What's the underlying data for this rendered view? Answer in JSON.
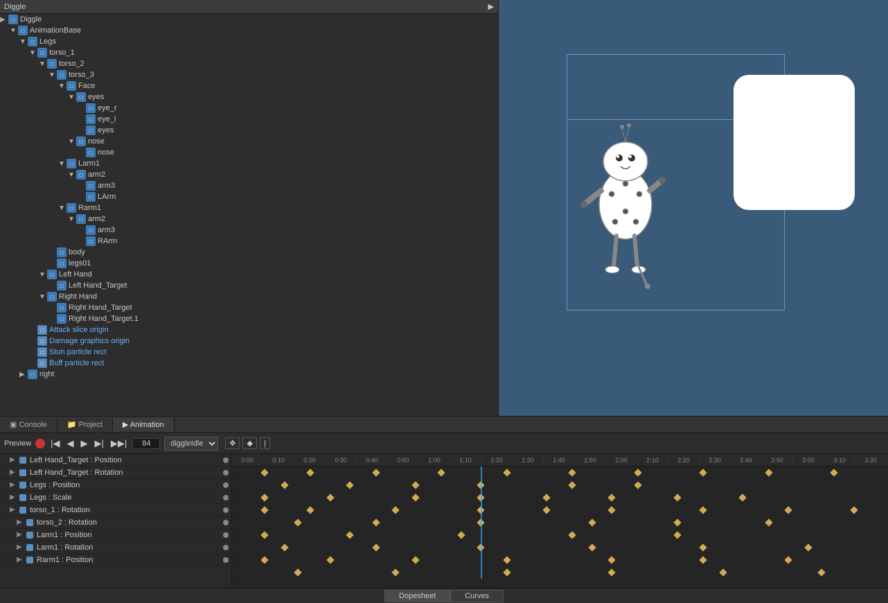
{
  "header": {
    "title": "Diggle"
  },
  "hierarchy": {
    "items": [
      {
        "id": "diggle",
        "label": "Diggle",
        "indent": 0,
        "arrow": "▶",
        "icon": "cube",
        "colored": false
      },
      {
        "id": "animation-base",
        "label": "AnimationBase",
        "indent": 1,
        "arrow": "▼",
        "icon": "cube",
        "colored": false
      },
      {
        "id": "legs",
        "label": "Legs",
        "indent": 2,
        "arrow": "▼",
        "icon": "cube",
        "colored": false
      },
      {
        "id": "torso_1",
        "label": "torso_1",
        "indent": 3,
        "arrow": "▼",
        "icon": "cube",
        "colored": false
      },
      {
        "id": "torso_2",
        "label": "torso_2",
        "indent": 4,
        "arrow": "▼",
        "icon": "cube",
        "colored": false
      },
      {
        "id": "torso_3",
        "label": "torso_3",
        "indent": 5,
        "arrow": "▼",
        "icon": "cube",
        "colored": false
      },
      {
        "id": "face",
        "label": "Face",
        "indent": 6,
        "arrow": "▼",
        "icon": "cube",
        "colored": false
      },
      {
        "id": "eyes",
        "label": "eyes",
        "indent": 7,
        "arrow": "▼",
        "icon": "cube",
        "colored": false
      },
      {
        "id": "eye_r",
        "label": "eye_r",
        "indent": 8,
        "arrow": "",
        "icon": "cube",
        "colored": false
      },
      {
        "id": "eye_l",
        "label": "eye_l",
        "indent": 8,
        "arrow": "",
        "icon": "cube",
        "colored": false
      },
      {
        "id": "eyes2",
        "label": "eyes",
        "indent": 8,
        "arrow": "",
        "icon": "cube",
        "colored": false
      },
      {
        "id": "nose-group",
        "label": "nose",
        "indent": 7,
        "arrow": "▼",
        "icon": "cube",
        "colored": false
      },
      {
        "id": "nose",
        "label": "nose",
        "indent": 8,
        "arrow": "",
        "icon": "cube",
        "colored": false
      },
      {
        "id": "larm1",
        "label": "Larm1",
        "indent": 6,
        "arrow": "▼",
        "icon": "cube",
        "colored": false
      },
      {
        "id": "larm1-arm2",
        "label": "arm2",
        "indent": 7,
        "arrow": "▼",
        "icon": "cube",
        "colored": false
      },
      {
        "id": "larm1-arm3",
        "label": "arm3",
        "indent": 8,
        "arrow": "",
        "icon": "cube",
        "colored": false
      },
      {
        "id": "larm",
        "label": "LArm",
        "indent": 8,
        "arrow": "",
        "icon": "cube",
        "colored": false
      },
      {
        "id": "rarm1",
        "label": "Rarm1",
        "indent": 6,
        "arrow": "▼",
        "icon": "cube",
        "colored": false
      },
      {
        "id": "rarm1-arm2",
        "label": "arm2",
        "indent": 7,
        "arrow": "▼",
        "icon": "cube",
        "colored": false
      },
      {
        "id": "rarm1-arm3",
        "label": "arm3",
        "indent": 8,
        "arrow": "",
        "icon": "cube",
        "colored": false
      },
      {
        "id": "rarm",
        "label": "RArm",
        "indent": 8,
        "arrow": "",
        "icon": "cube",
        "colored": false
      },
      {
        "id": "body",
        "label": "body",
        "indent": 5,
        "arrow": "",
        "icon": "cube",
        "colored": false
      },
      {
        "id": "legs01",
        "label": "legs01",
        "indent": 5,
        "arrow": "",
        "icon": "cube",
        "colored": false
      },
      {
        "id": "left-hand",
        "label": "Left Hand",
        "indent": 4,
        "arrow": "▼",
        "icon": "cube",
        "colored": false
      },
      {
        "id": "left-hand-target",
        "label": "Left Hand_Target",
        "indent": 5,
        "arrow": "",
        "icon": "cube",
        "colored": false
      },
      {
        "id": "right-hand",
        "label": "Right Hand",
        "indent": 4,
        "arrow": "▼",
        "icon": "cube",
        "colored": false
      },
      {
        "id": "right-hand-target",
        "label": "Right Hand_Target",
        "indent": 5,
        "arrow": "",
        "icon": "cube",
        "colored": false
      },
      {
        "id": "right-hand-target1",
        "label": "Right Hand_Target.1",
        "indent": 5,
        "arrow": "",
        "icon": "cube",
        "colored": false
      },
      {
        "id": "attack-slice",
        "label": "Attack slice origin",
        "indent": 3,
        "arrow": "",
        "icon": "cube",
        "colored": true
      },
      {
        "id": "damage-graphics",
        "label": "Damage graphics origin",
        "indent": 3,
        "arrow": "",
        "icon": "cube",
        "colored": true
      },
      {
        "id": "stun-particle",
        "label": "Stun particle rect",
        "indent": 3,
        "arrow": "",
        "icon": "cube",
        "colored": true
      },
      {
        "id": "buff-particle",
        "label": "Buff particle rect",
        "indent": 3,
        "arrow": "",
        "icon": "cube",
        "colored": true
      },
      {
        "id": "right",
        "label": "right",
        "indent": 2,
        "arrow": "▶",
        "icon": "cube",
        "colored": false
      }
    ]
  },
  "tabs": {
    "console": "Console",
    "project": "Project",
    "animation": "Animation"
  },
  "animation": {
    "preview_label": "Preview",
    "frame": "84",
    "clip_name": "diggleIdle",
    "ticks": [
      "0:00",
      "0:10",
      "0:20",
      "0:30",
      "0:40",
      "0:50",
      "1:00",
      "1:10",
      "1:20",
      "1:30",
      "1:40",
      "1:50",
      "2:00",
      "2:10",
      "2:20",
      "2:30",
      "2:40",
      "2:50",
      "3:00",
      "3:10",
      "3:20"
    ],
    "tracks": [
      {
        "label": "Left Hand_Target : Position",
        "indent": 1
      },
      {
        "label": "Left Hand_Target : Rotation",
        "indent": 1
      },
      {
        "label": "Legs : Position",
        "indent": 1
      },
      {
        "label": "Legs : Scale",
        "indent": 1
      },
      {
        "label": "torso_1 : Rotation",
        "indent": 1
      },
      {
        "label": "torso_2 : Rotation",
        "indent": 2
      },
      {
        "label": "Larm1 : Position",
        "indent": 2
      },
      {
        "label": "Larm1 : Rotation",
        "indent": 2
      },
      {
        "label": "Rarm1 : Position",
        "indent": 2
      }
    ],
    "dopesheet_label": "Dopesheet",
    "curves_label": "Curves"
  }
}
